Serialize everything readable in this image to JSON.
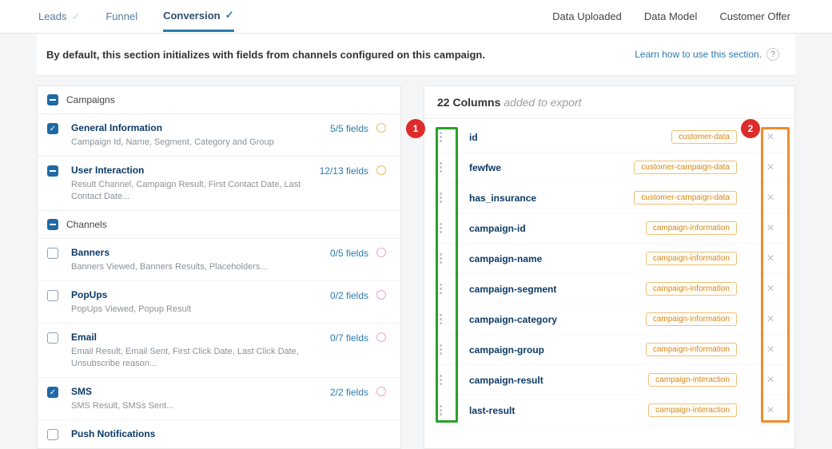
{
  "topbar": {
    "tabs": [
      {
        "label": "Leads",
        "active": false
      },
      {
        "label": "Funnel",
        "active": false
      },
      {
        "label": "Conversion",
        "active": true
      }
    ],
    "rightLinks": [
      "Data Uploaded",
      "Data Model",
      "Customer Offer"
    ]
  },
  "infobar": {
    "text": "By default, this section initializes with fields from channels configured on this campaign.",
    "learn": "Learn how to use this section."
  },
  "left": {
    "groups": [
      {
        "name": "Campaigns",
        "items": [
          {
            "checked": true,
            "title": "General Information",
            "desc": "Campaign Id, Name, Segment, Category and Group",
            "fields": "5/5 fields",
            "dot": "gold"
          },
          {
            "checked": true,
            "kind": "minus",
            "title": "User Interaction",
            "desc": "Result Channel, Campaign Result, First Contact Date, Last Contact Date...",
            "fields": "12/13 fields",
            "dot": "gold"
          }
        ]
      },
      {
        "name": "Channels",
        "items": [
          {
            "checked": false,
            "title": "Banners",
            "desc": "Banners Viewed, Banners Results, Placeholders...",
            "fields": "0/5 fields",
            "dot": "pink"
          },
          {
            "checked": false,
            "title": "PopUps",
            "desc": "PopUps Viewed, Popup Result",
            "fields": "0/2 fields",
            "dot": "pink"
          },
          {
            "checked": false,
            "title": "Email",
            "desc": "Email Result, Email Sent, First Click Date, Last Click Date, Unsubscribe reason...",
            "fields": "0/7 fields",
            "dot": "pink"
          },
          {
            "checked": true,
            "title": "SMS",
            "desc": "SMS Result, SMSs Sent...",
            "fields": "2/2 fields",
            "dot": "pink"
          },
          {
            "checked": false,
            "title": "Push Notifications",
            "desc": "",
            "fields": "",
            "dot": ""
          }
        ]
      }
    ]
  },
  "right": {
    "count": "22 Columns",
    "subtitle": "added to export",
    "columns": [
      {
        "name": "id",
        "tag": "customer-data"
      },
      {
        "name": "fewfwe",
        "tag": "customer-campaign-data"
      },
      {
        "name": "has_insurance",
        "tag": "customer-campaign-data"
      },
      {
        "name": "campaign-id",
        "tag": "campaign-information"
      },
      {
        "name": "campaign-name",
        "tag": "campaign-information"
      },
      {
        "name": "campaign-segment",
        "tag": "campaign-information"
      },
      {
        "name": "campaign-category",
        "tag": "campaign-information"
      },
      {
        "name": "campaign-group",
        "tag": "campaign-information"
      },
      {
        "name": "campaign-result",
        "tag": "campaign-interaction"
      },
      {
        "name": "last-result",
        "tag": "campaign-interaction"
      }
    ]
  },
  "callouts": {
    "one": "1",
    "two": "2"
  }
}
